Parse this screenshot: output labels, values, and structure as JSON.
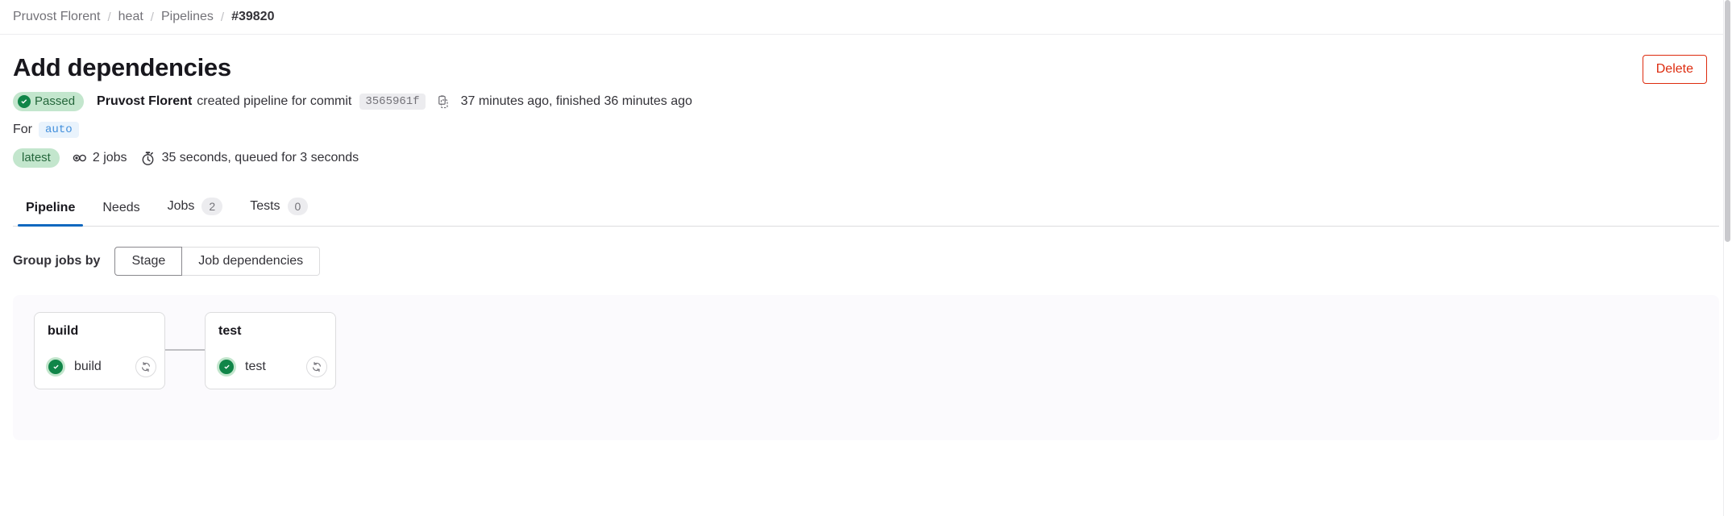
{
  "breadcrumb": {
    "items": [
      {
        "label": "Pruvost Florent",
        "current": false
      },
      {
        "label": "heat",
        "current": false
      },
      {
        "label": "Pipelines",
        "current": false
      },
      {
        "label": "#39820",
        "current": true
      }
    ],
    "separator": "/"
  },
  "header": {
    "title": "Add dependencies",
    "delete_label": "Delete"
  },
  "status": {
    "badge_label": "Passed",
    "badge_bg": "#c3e6cd",
    "badge_text_color": "#24663b",
    "icon": "check-circle-icon"
  },
  "commit_line": {
    "author": "Pruvost Florent",
    "action_text": "created pipeline for commit",
    "sha": "3565961f",
    "copy_icon": "copy-to-clipboard-icon",
    "timing": "37 minutes ago, finished 36 minutes ago"
  },
  "ref_line": {
    "prefix": "For",
    "ref": "auto"
  },
  "summary_line": {
    "latest_label": "latest",
    "jobs_icon": "pipeline-jobs-icon",
    "jobs_text": "2 jobs",
    "duration_icon": "stopwatch-icon",
    "duration_text": "35 seconds, queued for 3 seconds"
  },
  "tabs": [
    {
      "label": "Pipeline",
      "count": null,
      "active": true
    },
    {
      "label": "Needs",
      "count": null,
      "active": false
    },
    {
      "label": "Jobs",
      "count": "2",
      "active": false
    },
    {
      "label": "Tests",
      "count": "0",
      "active": false
    }
  ],
  "group_by": {
    "label": "Group jobs by",
    "options": [
      {
        "label": "Stage",
        "selected": true
      },
      {
        "label": "Job dependencies",
        "selected": false
      }
    ]
  },
  "pipeline_graph": {
    "stages": [
      {
        "name": "build",
        "jobs": [
          {
            "name": "build",
            "status": "success",
            "retry_icon": "retry-icon"
          }
        ]
      },
      {
        "name": "test",
        "jobs": [
          {
            "name": "test",
            "status": "success",
            "retry_icon": "retry-icon"
          }
        ]
      }
    ]
  },
  "colors": {
    "accent_blue": "#1068bf",
    "success_green": "#108548",
    "danger_red": "#dd2b0e",
    "panel_bg": "#fbfafd"
  }
}
